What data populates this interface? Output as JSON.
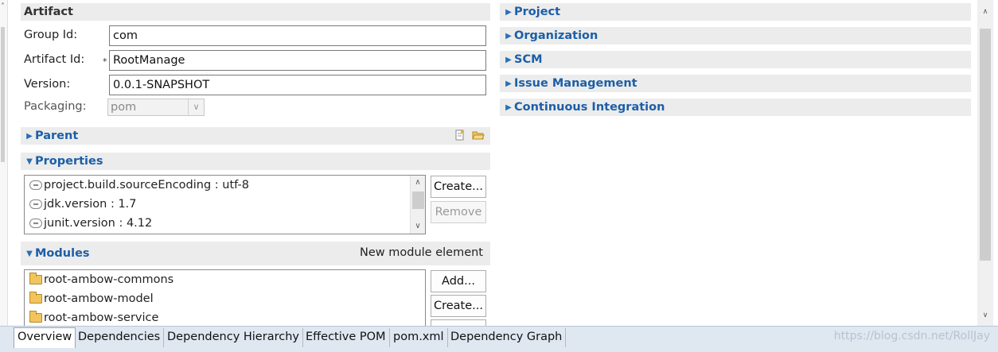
{
  "artifact": {
    "header": "Artifact",
    "group_id_label": "Group Id:",
    "group_id_value": "com",
    "artifact_id_label": "Artifact Id:",
    "artifact_id_value": "RootManage",
    "required_marker": "*",
    "version_label": "Version:",
    "version_value": "0.0.1-SNAPSHOT",
    "packaging_label": "Packaging:",
    "packaging_value": "pom"
  },
  "parent": {
    "header": "Parent",
    "icons": [
      "new-file-icon",
      "open-folder-icon"
    ]
  },
  "properties": {
    "header": "Properties",
    "items": [
      "project.build.sourceEncoding : utf-8",
      "jdk.version : 1.7",
      "junit.version : 4.12"
    ],
    "create_label": "Create...",
    "remove_label": "Remove"
  },
  "modules": {
    "header": "Modules",
    "new_element_label": "New module element",
    "items": [
      "root-ambow-commons",
      "root-ambow-model",
      "root-ambow-service"
    ],
    "add_label": "Add...",
    "create_label": "Create..."
  },
  "right_sections": [
    "Project",
    "Organization",
    "SCM",
    "Issue Management",
    "Continuous Integration"
  ],
  "tabs": [
    "Overview",
    "Dependencies",
    "Dependency Hierarchy",
    "Effective POM",
    "pom.xml",
    "Dependency Graph"
  ],
  "active_tab": "Overview",
  "watermark": "https://blog.csdn.net/RollJay",
  "colors": {
    "section_title": "#1b5fa8",
    "section_bg": "#ececec",
    "tabbar_bg": "#dfe7f1"
  }
}
